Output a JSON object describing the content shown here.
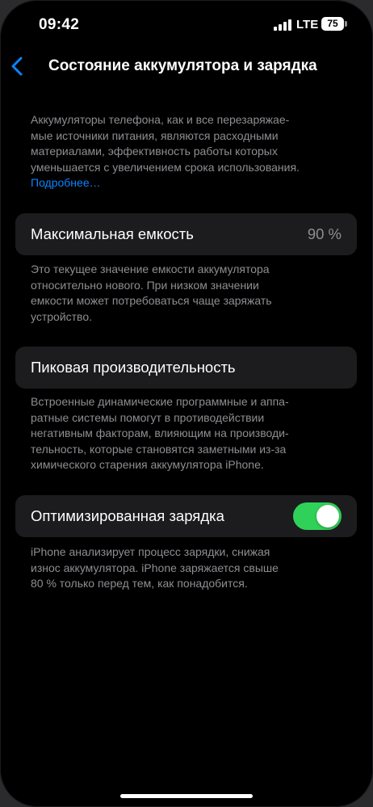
{
  "status_bar": {
    "time": "09:42",
    "carrier": "LTE",
    "battery": "75"
  },
  "nav": {
    "back_icon": "chevron-left-icon",
    "title": "Состояние аккумулятора и зарядка"
  },
  "intro": {
    "lines": [
      "Аккумуляторы телефона, как и все перезаряжае-",
      "мые источники питания, являются расходными",
      "материалами, эффективность работы которых",
      "уменьшается с увеличением срока использования."
    ],
    "link": "Подробнее…"
  },
  "max_capacity": {
    "label": "Максимальная емкость",
    "value": "90 %",
    "footer_lines": [
      "Это текущее значение емкости аккумулятора",
      "относительно нового. При низком значении",
      "емкости может потребоваться чаще заряжать",
      "устройство."
    ]
  },
  "peak_performance": {
    "label": "Пиковая производительность",
    "footer_lines": [
      "Встроенные динамические программные и аппа-",
      "ратные системы помогут в противодействии",
      "негативным факторам, влияющим на производи-",
      "тельность, которые становятся заметными из-за",
      "химического старения аккумулятора iPhone."
    ]
  },
  "optimized_charging": {
    "label": "Оптимизированная зарядка",
    "enabled": true,
    "footer_lines": [
      "iPhone анализирует процесс зарядки, снижая",
      "износ аккумулятора. iPhone заряжается свыше",
      "80 % только перед тем, как понадобится."
    ]
  },
  "colors": {
    "accent": "#0a84ff",
    "toggle_on": "#30d158",
    "card_bg": "#1c1c1e",
    "secondary_text": "#8e8e93"
  }
}
